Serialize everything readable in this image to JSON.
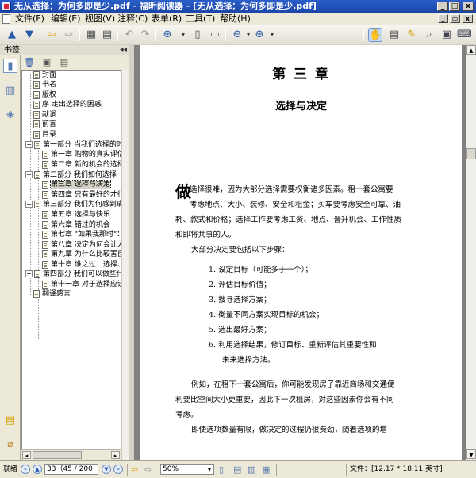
{
  "window": {
    "title": "无从选择：为何多即是少.pdf - 福昕阅读器 - [无从选择：为何多即是少.pdf]",
    "min_label": "_",
    "max_label": "□",
    "close_label": "x"
  },
  "menu": {
    "items": [
      "文件(F)",
      "编辑(E)",
      "视图(V)",
      "注释(C)",
      "表单(R)",
      "工具(T)",
      "帮助(H)"
    ],
    "mdi_min": "_",
    "mdi_restore": "▭",
    "mdi_close": "x"
  },
  "toolbar": {
    "icons": [
      "up-arrow-icon",
      "down-arrow-icon",
      "back-arrow-icon",
      "forward-arrow-icon",
      "page-layout-icon",
      "save-icon",
      "undo-icon",
      "redo-icon",
      "zoom-icon",
      "fit-page-icon",
      "fit-width-icon",
      "zoom-out-icon",
      "zoom-in-icon",
      "hand-tool-icon",
      "select-text-icon",
      "highlight-icon",
      "search-icon",
      "snapshot-icon",
      "typewriter-icon"
    ]
  },
  "sidebar": {
    "header": "书签",
    "collapse_icon": "◂◂",
    "bookmarks": [
      {
        "label": "封面",
        "level": 0,
        "expand": ""
      },
      {
        "label": "书名",
        "level": 0,
        "expand": ""
      },
      {
        "label": "版权",
        "level": 0,
        "expand": ""
      },
      {
        "label": "序 走出选择的困惑",
        "level": 0,
        "expand": ""
      },
      {
        "label": "献词",
        "level": 0,
        "expand": ""
      },
      {
        "label": "前言",
        "level": 0,
        "expand": ""
      },
      {
        "label": "目录",
        "level": 0,
        "expand": ""
      },
      {
        "label": "第一部分 当我们选择的时候",
        "level": 0,
        "expand": "−"
      },
      {
        "label": "第一章 购物的真实评估",
        "level": 1,
        "expand": ""
      },
      {
        "label": "第二章 新的机会的选择",
        "level": 1,
        "expand": ""
      },
      {
        "label": "第二部分 我们如何选择",
        "level": 0,
        "expand": "−"
      },
      {
        "label": "第三章 选择与决定",
        "level": 1,
        "expand": "",
        "selected": true
      },
      {
        "label": "第四章 只有最好的才行",
        "level": 1,
        "expand": ""
      },
      {
        "label": "第三部分 我们为何感到痛苦",
        "level": 0,
        "expand": "−"
      },
      {
        "label": "第五章 选择与快乐",
        "level": 1,
        "expand": ""
      },
      {
        "label": "第六章 错过的机会",
        "level": 1,
        "expand": ""
      },
      {
        "label": "第七章 \"如果我那时\"：",
        "level": 1,
        "expand": ""
      },
      {
        "label": "第八章 决定为何会让人",
        "level": 1,
        "expand": ""
      },
      {
        "label": "第九章 为什么比较害自",
        "level": 1,
        "expand": ""
      },
      {
        "label": "第十章 谁之过：选择、",
        "level": 1,
        "expand": ""
      },
      {
        "label": "第四部分 我们可以做些什么",
        "level": 0,
        "expand": "−"
      },
      {
        "label": "第十一章 对于选择应该",
        "level": 1,
        "expand": ""
      },
      {
        "label": "翻译感言",
        "level": 0,
        "expand": ""
      }
    ],
    "scroll_left": "◂",
    "scroll_right": "▸"
  },
  "document": {
    "chapter": "第 三 章",
    "chapter_title": "选择与决定",
    "dropcap": "做",
    "intro_lines": [
      "选择很难，因为大部分选择需要权衡诸多因素。租一套公寓要",
      "考虑地点、大小、装修、安全和租金；买车要考虑安全可靠、油",
      "耗、款式和价格；选择工作要考虑工资、地点、晋升机会、工作性质",
      "和即将共事的人。"
    ],
    "steps_intro": "大部分决定要包括以下步骤：",
    "steps": [
      "1. 设定目标（可能多于一个）；",
      "2. 评估目标价值；",
      "3. 搜寻选择方案；",
      "4. 衡量不同方案实现目标的机会；",
      "5. 选出最好方案；",
      "6. 利用选择结果，修订目标、重新评估其重要性和",
      "未来选择方法。"
    ],
    "example_lines": [
      "例如，在租下一套公寓后，你可能发现房子靠近商场和交通便",
      "利要比空间大小更重要，因此下一次租房，对这些因素你会有不同",
      "考虑。",
      "即使选项数量有限，做决定的过程仍很费劲，随着选项的增"
    ]
  },
  "status": {
    "ready": "就绪",
    "page_field": "33（45 / 200",
    "zoom": "50%",
    "doc_size": "文件：[12.17 * 18.11 英寸]"
  }
}
